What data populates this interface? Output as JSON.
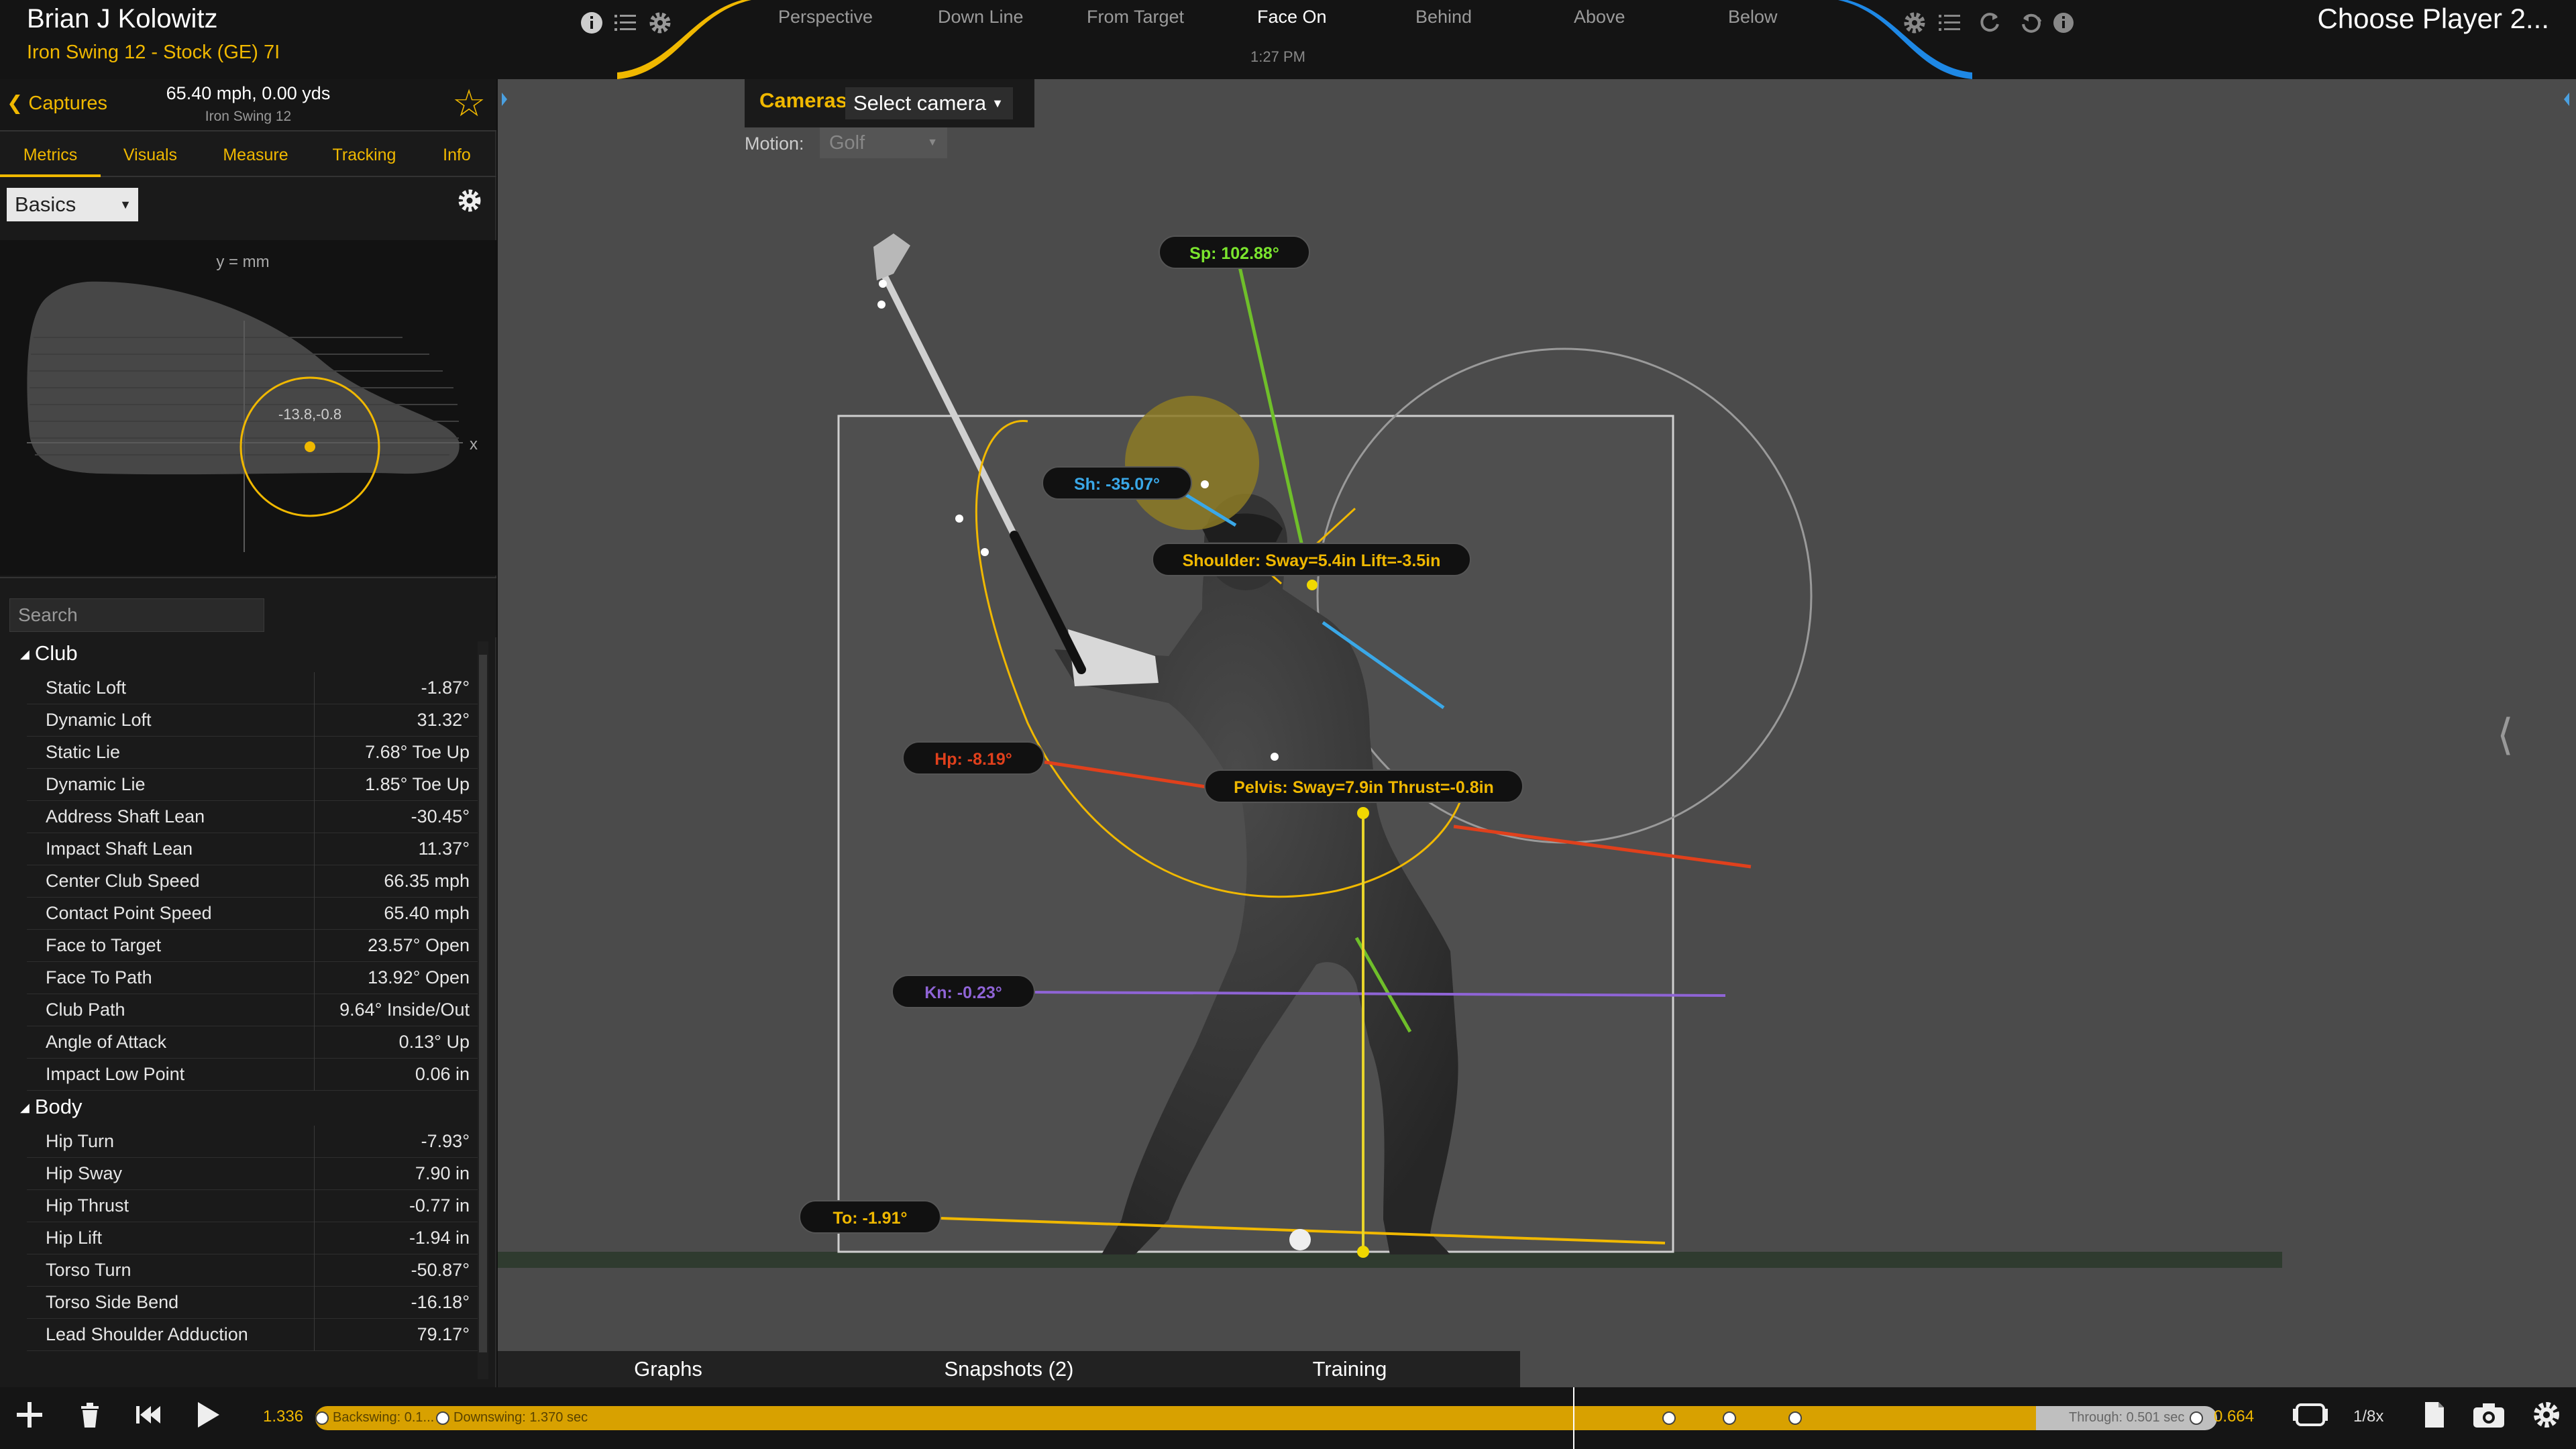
{
  "header": {
    "player_name": "Brian J Kolowitz",
    "swing_label": "Iron Swing 12 - Stock (GE) 7I",
    "time": "1:27 PM",
    "choose_player": "Choose Player 2...",
    "views": [
      {
        "label": "Perspective"
      },
      {
        "label": "Down Line"
      },
      {
        "label": "From Target"
      },
      {
        "label": "Face On",
        "active": true
      },
      {
        "label": "Behind"
      },
      {
        "label": "Above"
      },
      {
        "label": "Below"
      }
    ],
    "accent_left": "#f0b800",
    "accent_right": "#1e88e5"
  },
  "left_panel": {
    "captures_label": "Captures",
    "capture_speed": "65.40 mph, 0.00 yds",
    "capture_name": "Iron Swing 12",
    "tabs": [
      "Metrics",
      "Visuals",
      "Measure",
      "Tracking",
      "Info"
    ],
    "active_tab": "Metrics",
    "basics_select": "Basics",
    "face_plot": {
      "y_label": "y = mm",
      "x_label": "x",
      "impact_label": "-13.8,-0.8"
    },
    "search_placeholder": "Search",
    "groups": [
      {
        "name": "Club",
        "rows": [
          {
            "name": "Static Loft",
            "value": "-1.87°"
          },
          {
            "name": "Dynamic Loft",
            "value": "31.32°"
          },
          {
            "name": "Static Lie",
            "value": "7.68° Toe Up"
          },
          {
            "name": "Dynamic Lie",
            "value": "1.85° Toe Up"
          },
          {
            "name": "Address Shaft Lean",
            "value": "-30.45°"
          },
          {
            "name": "Impact Shaft Lean",
            "value": "11.37°"
          },
          {
            "name": "Center Club Speed",
            "value": "66.35 mph"
          },
          {
            "name": "Contact Point Speed",
            "value": "65.40 mph"
          },
          {
            "name": "Face to Target",
            "value": "23.57° Open"
          },
          {
            "name": "Face To Path",
            "value": "13.92° Open"
          },
          {
            "name": "Club Path",
            "value": "9.64° Inside/Out"
          },
          {
            "name": "Angle of Attack",
            "value": "0.13° Up"
          },
          {
            "name": "Impact Low Point",
            "value": "0.06 in"
          }
        ]
      },
      {
        "name": "Body",
        "rows": [
          {
            "name": "Hip Turn",
            "value": "-7.93°"
          },
          {
            "name": "Hip Sway",
            "value": "7.90 in"
          },
          {
            "name": "Hip Thrust",
            "value": "-0.77 in"
          },
          {
            "name": "Hip Lift",
            "value": "-1.94 in"
          },
          {
            "name": "Torso Turn",
            "value": "-50.87°"
          },
          {
            "name": "Torso Side Bend",
            "value": "-16.18°"
          },
          {
            "name": "Lead Shoulder Adduction",
            "value": "79.17°"
          }
        ]
      }
    ]
  },
  "viewport": {
    "cameras_label": "Cameras",
    "camera_select": "Select camera",
    "motion_label": "Motion:",
    "motion_select": "Golf",
    "labels": {
      "sp": "Sp: 102.88°",
      "sh": "Sh: -35.07°",
      "shoulder": "Shoulder: Sway=5.4in Lift=-3.5in",
      "hp": "Hp: -8.19°",
      "pelvis": "Pelvis: Sway=7.9in Thrust=-0.8in",
      "kn": "Kn: -0.23°",
      "to": "To: -1.91°"
    },
    "bottom_tabs": [
      "Graphs",
      "Snapshots (2)",
      "Training"
    ]
  },
  "timeline": {
    "start": "1.336",
    "backswing": "Backswing: 0.1...",
    "downswing": "Downswing: 1.370 sec",
    "through": "Through: 0.501 sec",
    "end": "0.664",
    "speed": "1/8x"
  }
}
